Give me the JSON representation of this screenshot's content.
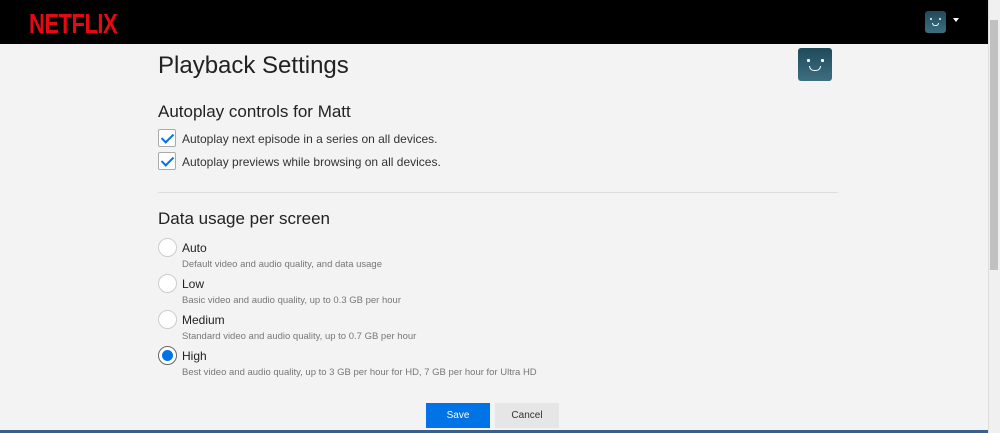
{
  "header": {
    "logo": "NETFLIX"
  },
  "page": {
    "title": "Playback Settings"
  },
  "autoplay": {
    "heading": "Autoplay controls for Matt",
    "options": [
      {
        "label": "Autoplay next episode in a series on all devices.",
        "checked": true
      },
      {
        "label": "Autoplay previews while browsing on all devices.",
        "checked": true
      }
    ]
  },
  "data_usage": {
    "heading": "Data usage per screen",
    "selected": "High",
    "options": [
      {
        "label": "Auto",
        "desc": "Default video and audio quality, and data usage"
      },
      {
        "label": "Low",
        "desc": "Basic video and audio quality, up to 0.3 GB per hour"
      },
      {
        "label": "Medium",
        "desc": "Standard video and audio quality, up to 0.7 GB per hour"
      },
      {
        "label": "High",
        "desc": "Best video and audio quality, up to 3 GB per hour for HD, 7 GB per hour for Ultra HD"
      }
    ]
  },
  "buttons": {
    "save": "Save",
    "cancel": "Cancel"
  },
  "colors": {
    "brand": "#e50914",
    "accent": "#0073e6"
  }
}
